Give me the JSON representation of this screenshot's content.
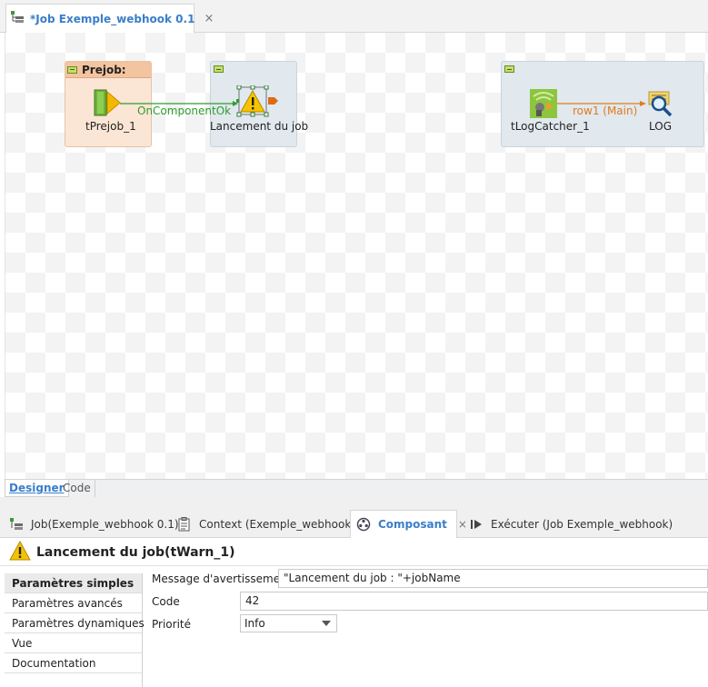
{
  "editor": {
    "tab_title": "*Job Exemple_webhook 0.1",
    "tab_icon": "job-icon"
  },
  "canvas": {
    "prejob_header": "Prejob:",
    "components": [
      {
        "label": "tPrejob_1",
        "icon": "prejob-icon"
      },
      {
        "label": "Lancement du job",
        "icon": "warning-icon"
      },
      {
        "label": "tLogCatcher_1",
        "icon": "logcatcher-icon"
      },
      {
        "label": "LOG",
        "icon": "log-magnifier-icon"
      }
    ],
    "links": {
      "on_component_ok": "OnComponentOk",
      "row_main": "row1 (Main)"
    },
    "colors": {
      "link_green": "#2e9c2e",
      "link_orange": "#e07b1b"
    }
  },
  "designer_tabs": {
    "designer": "Designer",
    "code": "Code"
  },
  "views": {
    "tabs": [
      {
        "label": "Job(Exemple_webhook 0.1)",
        "icon": "job-icon"
      },
      {
        "label": "Context (Exemple_webhook)",
        "icon": "context-icon"
      },
      {
        "label": "Composant",
        "icon": "component-icon",
        "close": "×"
      },
      {
        "label": "Exécuter (Job Exemple_webhook)",
        "icon": "run-icon"
      }
    ]
  },
  "component": {
    "title": "Lancement du job(tWarn_1)",
    "nav": [
      "Paramètres simples",
      "Paramètres avancés",
      "Paramètres dynamiques",
      "Vue",
      "Documentation"
    ],
    "fields": {
      "message_label": "Message d'avertissement",
      "message_value": "\"Lancement du job : \"+jobName",
      "code_label": "Code",
      "code_value": "42",
      "priority_label": "Priorité",
      "priority_value": "Info"
    }
  }
}
